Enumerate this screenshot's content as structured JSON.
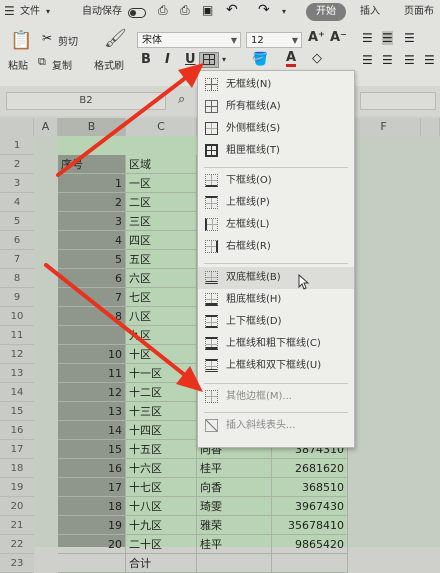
{
  "ribbon": {
    "menu_file": "文件",
    "autosave": "自动保存",
    "tab_start": "开始",
    "tab_insert": "插入",
    "tab_layout": "页面布",
    "cut": "剪切",
    "paste": "粘贴",
    "copy": "复制",
    "format_painter": "格式刷",
    "font_name": "宋体",
    "font_size": "12",
    "bold": "B",
    "italic": "I",
    "underline": "U",
    "grow_font": "A⁺",
    "shrink_font": "A⁻"
  },
  "formula_bar": {
    "name_box": "B2"
  },
  "grid": {
    "columns": [
      "A",
      "B",
      "C",
      "F"
    ],
    "rows": [
      "1",
      "2",
      "3",
      "4",
      "5",
      "6",
      "7",
      "8",
      "9",
      "10",
      "11",
      "12",
      "13",
      "14",
      "15",
      "16",
      "17",
      "18",
      "19",
      "20",
      "21",
      "22",
      "23"
    ],
    "header": {
      "seq": "序号",
      "region": "区域"
    },
    "region_labels": [
      "一区",
      "二区",
      "三区",
      "四区",
      "五区",
      "六区",
      "七区",
      "八区",
      "九区",
      "十区",
      "十一区",
      "十二区",
      "十三区",
      "十四区",
      "十五区",
      "十六区",
      "十七区",
      "十八区",
      "十九区",
      "二十区",
      "合计"
    ],
    "rows_data": [
      {
        "seq": "1",
        "region": "一区"
      },
      {
        "seq": "2",
        "region": "二区"
      },
      {
        "seq": "3",
        "region": "三区"
      },
      {
        "seq": "4",
        "region": "四区"
      },
      {
        "seq": "5",
        "region": "五区"
      },
      {
        "seq": "6",
        "region": "六区"
      },
      {
        "seq": "7",
        "region": "七区"
      },
      {
        "seq": "8",
        "region": "八区"
      },
      {
        "seq": "",
        "region": "九区"
      },
      {
        "seq": "10",
        "region": "十区"
      },
      {
        "seq": "11",
        "region": "十一区"
      },
      {
        "seq": "12",
        "region": "十二区"
      },
      {
        "seq": "13",
        "region": "十三区"
      },
      {
        "seq": "14",
        "region": "十四区"
      },
      {
        "seq": "15",
        "region": "十五区",
        "name": "向香",
        "value": "3874310"
      },
      {
        "seq": "16",
        "region": "十六区",
        "name": "桂平",
        "value": "2681620"
      },
      {
        "seq": "17",
        "region": "十七区",
        "name": "向香",
        "value": "368510"
      },
      {
        "seq": "18",
        "region": "十八区",
        "name": "琦雯",
        "value": "3967430"
      },
      {
        "seq": "19",
        "region": "十九区",
        "name": "雅荣",
        "value": "35678410"
      },
      {
        "seq": "20",
        "region": "二十区",
        "name": "桂平",
        "value": "9865420"
      },
      {
        "seq": "",
        "region": "合计"
      }
    ]
  },
  "border_menu": {
    "items": [
      {
        "label": "无框线(N)",
        "icon": "no-border-icon"
      },
      {
        "label": "所有框线(A)",
        "icon": "all-borders-icon"
      },
      {
        "label": "外侧框线(S)",
        "icon": "outside-borders-icon"
      },
      {
        "label": "粗匣框线(T)",
        "icon": "thick-box-border-icon"
      },
      {
        "label": "下框线(O)",
        "icon": "bottom-border-icon"
      },
      {
        "label": "上框线(P)",
        "icon": "top-border-icon"
      },
      {
        "label": "左框线(L)",
        "icon": "left-border-icon"
      },
      {
        "label": "右框线(R)",
        "icon": "right-border-icon"
      },
      {
        "label": "双底框线(B)",
        "icon": "double-bottom-border-icon"
      },
      {
        "label": "粗底框线(H)",
        "icon": "thick-bottom-border-icon"
      },
      {
        "label": "上下框线(D)",
        "icon": "top-bottom-border-icon"
      },
      {
        "label": "上框线和粗下框线(C)",
        "icon": "top-thick-bottom-border-icon"
      },
      {
        "label": "上框线和双下框线(U)",
        "icon": "top-double-bottom-border-icon"
      },
      {
        "label": "其他边框(M)...",
        "icon": "more-borders-icon"
      },
      {
        "label": "插入斜线表头...",
        "icon": "diagonal-header-icon"
      }
    ]
  },
  "colors": {
    "selection": "#8f968b",
    "green_fill": "#b9d4b4",
    "arrow": "#e8321e"
  }
}
